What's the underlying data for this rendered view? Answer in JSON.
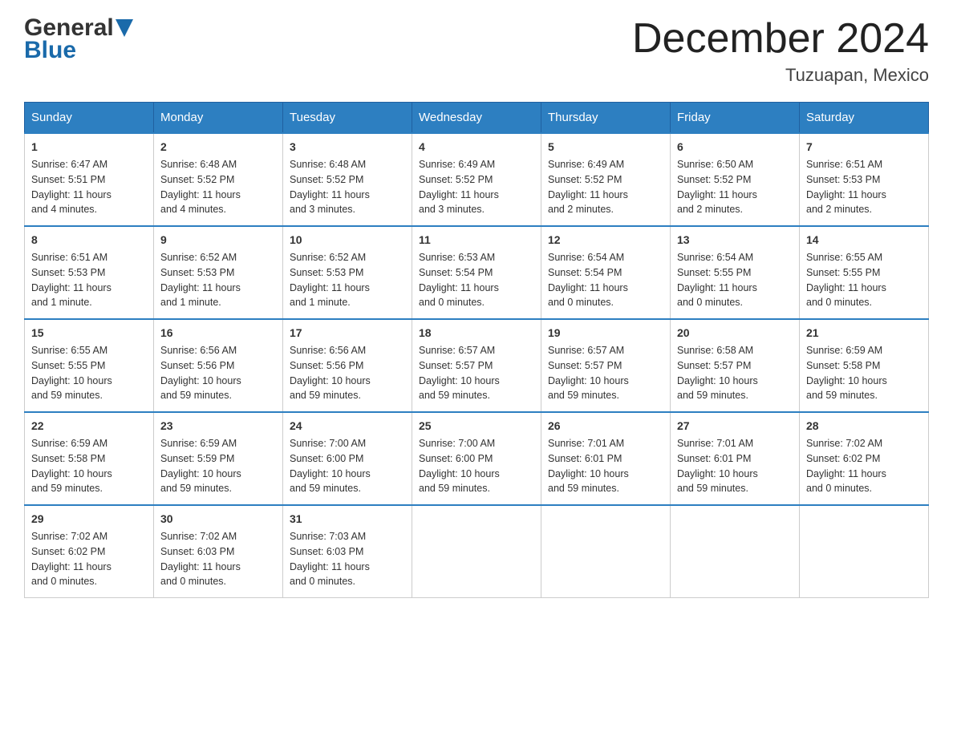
{
  "header": {
    "logo_general": "General",
    "logo_blue": "Blue",
    "month_year": "December 2024",
    "location": "Tuzuapan, Mexico"
  },
  "weekdays": [
    "Sunday",
    "Monday",
    "Tuesday",
    "Wednesday",
    "Thursday",
    "Friday",
    "Saturday"
  ],
  "weeks": [
    [
      {
        "day": "1",
        "info": "Sunrise: 6:47 AM\nSunset: 5:51 PM\nDaylight: 11 hours\nand 4 minutes."
      },
      {
        "day": "2",
        "info": "Sunrise: 6:48 AM\nSunset: 5:52 PM\nDaylight: 11 hours\nand 4 minutes."
      },
      {
        "day": "3",
        "info": "Sunrise: 6:48 AM\nSunset: 5:52 PM\nDaylight: 11 hours\nand 3 minutes."
      },
      {
        "day": "4",
        "info": "Sunrise: 6:49 AM\nSunset: 5:52 PM\nDaylight: 11 hours\nand 3 minutes."
      },
      {
        "day": "5",
        "info": "Sunrise: 6:49 AM\nSunset: 5:52 PM\nDaylight: 11 hours\nand 2 minutes."
      },
      {
        "day": "6",
        "info": "Sunrise: 6:50 AM\nSunset: 5:52 PM\nDaylight: 11 hours\nand 2 minutes."
      },
      {
        "day": "7",
        "info": "Sunrise: 6:51 AM\nSunset: 5:53 PM\nDaylight: 11 hours\nand 2 minutes."
      }
    ],
    [
      {
        "day": "8",
        "info": "Sunrise: 6:51 AM\nSunset: 5:53 PM\nDaylight: 11 hours\nand 1 minute."
      },
      {
        "day": "9",
        "info": "Sunrise: 6:52 AM\nSunset: 5:53 PM\nDaylight: 11 hours\nand 1 minute."
      },
      {
        "day": "10",
        "info": "Sunrise: 6:52 AM\nSunset: 5:53 PM\nDaylight: 11 hours\nand 1 minute."
      },
      {
        "day": "11",
        "info": "Sunrise: 6:53 AM\nSunset: 5:54 PM\nDaylight: 11 hours\nand 0 minutes."
      },
      {
        "day": "12",
        "info": "Sunrise: 6:54 AM\nSunset: 5:54 PM\nDaylight: 11 hours\nand 0 minutes."
      },
      {
        "day": "13",
        "info": "Sunrise: 6:54 AM\nSunset: 5:55 PM\nDaylight: 11 hours\nand 0 minutes."
      },
      {
        "day": "14",
        "info": "Sunrise: 6:55 AM\nSunset: 5:55 PM\nDaylight: 11 hours\nand 0 minutes."
      }
    ],
    [
      {
        "day": "15",
        "info": "Sunrise: 6:55 AM\nSunset: 5:55 PM\nDaylight: 10 hours\nand 59 minutes."
      },
      {
        "day": "16",
        "info": "Sunrise: 6:56 AM\nSunset: 5:56 PM\nDaylight: 10 hours\nand 59 minutes."
      },
      {
        "day": "17",
        "info": "Sunrise: 6:56 AM\nSunset: 5:56 PM\nDaylight: 10 hours\nand 59 minutes."
      },
      {
        "day": "18",
        "info": "Sunrise: 6:57 AM\nSunset: 5:57 PM\nDaylight: 10 hours\nand 59 minutes."
      },
      {
        "day": "19",
        "info": "Sunrise: 6:57 AM\nSunset: 5:57 PM\nDaylight: 10 hours\nand 59 minutes."
      },
      {
        "day": "20",
        "info": "Sunrise: 6:58 AM\nSunset: 5:57 PM\nDaylight: 10 hours\nand 59 minutes."
      },
      {
        "day": "21",
        "info": "Sunrise: 6:59 AM\nSunset: 5:58 PM\nDaylight: 10 hours\nand 59 minutes."
      }
    ],
    [
      {
        "day": "22",
        "info": "Sunrise: 6:59 AM\nSunset: 5:58 PM\nDaylight: 10 hours\nand 59 minutes."
      },
      {
        "day": "23",
        "info": "Sunrise: 6:59 AM\nSunset: 5:59 PM\nDaylight: 10 hours\nand 59 minutes."
      },
      {
        "day": "24",
        "info": "Sunrise: 7:00 AM\nSunset: 6:00 PM\nDaylight: 10 hours\nand 59 minutes."
      },
      {
        "day": "25",
        "info": "Sunrise: 7:00 AM\nSunset: 6:00 PM\nDaylight: 10 hours\nand 59 minutes."
      },
      {
        "day": "26",
        "info": "Sunrise: 7:01 AM\nSunset: 6:01 PM\nDaylight: 10 hours\nand 59 minutes."
      },
      {
        "day": "27",
        "info": "Sunrise: 7:01 AM\nSunset: 6:01 PM\nDaylight: 10 hours\nand 59 minutes."
      },
      {
        "day": "28",
        "info": "Sunrise: 7:02 AM\nSunset: 6:02 PM\nDaylight: 11 hours\nand 0 minutes."
      }
    ],
    [
      {
        "day": "29",
        "info": "Sunrise: 7:02 AM\nSunset: 6:02 PM\nDaylight: 11 hours\nand 0 minutes."
      },
      {
        "day": "30",
        "info": "Sunrise: 7:02 AM\nSunset: 6:03 PM\nDaylight: 11 hours\nand 0 minutes."
      },
      {
        "day": "31",
        "info": "Sunrise: 7:03 AM\nSunset: 6:03 PM\nDaylight: 11 hours\nand 0 minutes."
      },
      null,
      null,
      null,
      null
    ]
  ]
}
